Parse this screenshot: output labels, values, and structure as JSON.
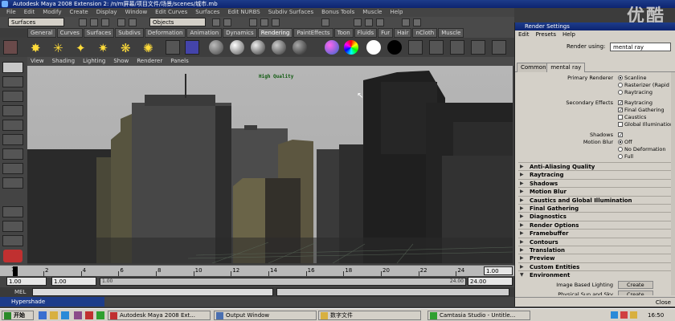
{
  "window": {
    "title": "Autodesk Maya 2008 Extension 2: /n/m屏幕/项目文件/场景/scenes/城市.mb",
    "watermark": "优酷"
  },
  "menubar": [
    "File",
    "Edit",
    "Modify",
    "Create",
    "Display",
    "Window",
    "Edit Curves",
    "Surfaces",
    "Edit NURBS",
    "Subdiv Surfaces",
    "Bonus Tools",
    "Muscle",
    "Help"
  ],
  "statusline": {
    "menuset": "Surfaces",
    "selection_mode": "Objects"
  },
  "shelf_tabs": [
    {
      "label": "General",
      "active": false
    },
    {
      "label": "Curves",
      "active": false
    },
    {
      "label": "Surfaces",
      "active": false
    },
    {
      "label": "Subdivs",
      "active": false
    },
    {
      "label": "Deformation",
      "active": false
    },
    {
      "label": "Animation",
      "active": false
    },
    {
      "label": "Dynamics",
      "active": false
    },
    {
      "label": "Rendering",
      "active": true
    },
    {
      "label": "PaintEffects",
      "active": false
    },
    {
      "label": "Toon",
      "active": false
    },
    {
      "label": "Fluids",
      "active": false
    },
    {
      "label": "Fur",
      "active": false
    },
    {
      "label": "Hair",
      "active": false
    },
    {
      "label": "nCloth",
      "active": false
    },
    {
      "label": "Muscle",
      "active": false
    }
  ],
  "panel_menu": [
    "View",
    "Shading",
    "Lighting",
    "Show",
    "Renderer",
    "Panels"
  ],
  "viewport": {
    "overlay_text": "High Quality"
  },
  "timeslider": {
    "ticks": [
      "2",
      "4",
      "6",
      "8",
      "10",
      "12",
      "14",
      "16",
      "18",
      "20",
      "22",
      "24"
    ],
    "current_frame": "1",
    "current_field": "1.00"
  },
  "range": {
    "start_time": "1.00",
    "playback_start": "1.00",
    "range_start_label": "1.00",
    "range_end_label": "24.00",
    "playback_end": "24.00"
  },
  "command_line": {
    "label": "MEL"
  },
  "render_settings": {
    "title": "Render Settings",
    "menus": [
      "Edit",
      "Presets",
      "Help"
    ],
    "render_using_label": "Render using:",
    "render_using_value": "mental ray",
    "tabs": [
      {
        "label": "Common",
        "active": false
      },
      {
        "label": "mental ray",
        "active": true
      }
    ],
    "primary_renderer_label": "Primary Renderer",
    "primary_renderer_options": [
      {
        "label": "Scanline",
        "selected": true
      },
      {
        "label": "Rasterizer (Rapid Motion)",
        "selected": false
      },
      {
        "label": "Raytracing",
        "selected": false
      }
    ],
    "secondary_effects_label": "Secondary Effects",
    "secondary_effects_options": [
      {
        "label": "Raytracing",
        "checked": true
      },
      {
        "label": "Final Gathering",
        "checked": true
      },
      {
        "label": "Caustics",
        "checked": false
      },
      {
        "label": "Global Illumination",
        "checked": false
      }
    ],
    "shadows_label": "Shadows",
    "shadows_checked": true,
    "motion_blur_label": "Motion Blur",
    "motion_blur_options": [
      {
        "label": "Off",
        "selected": true
      },
      {
        "label": "No Deformation",
        "selected": false
      },
      {
        "label": "Full",
        "selected": false
      }
    ],
    "sections": [
      {
        "label": "Anti-Aliasing Quality",
        "open": false
      },
      {
        "label": "Raytracing",
        "open": false
      },
      {
        "label": "Shadows",
        "open": false
      },
      {
        "label": "Motion Blur",
        "open": false
      },
      {
        "label": "Caustics and Global Illumination",
        "open": false
      },
      {
        "label": "Final Gathering",
        "open": false
      },
      {
        "label": "Diagnostics",
        "open": false
      },
      {
        "label": "Render Options",
        "open": false
      },
      {
        "label": "Framebuffer",
        "open": false
      },
      {
        "label": "Contours",
        "open": false
      },
      {
        "label": "Translation",
        "open": false
      },
      {
        "label": "Preview",
        "open": false
      },
      {
        "label": "Custom Entities",
        "open": false
      },
      {
        "label": "Environment",
        "open": true
      }
    ],
    "environment_items": [
      "Image Based Lighting",
      "Physical Sun and Sky"
    ],
    "create_label": "Create",
    "close_label": "Close"
  },
  "taskbar": {
    "start_label": "开始",
    "buttons": [
      "Autodesk Maya 2008 Ext...",
      "Output Window",
      "数字文件",
      "Camtasia Studio - Untitle..."
    ],
    "clock": "16:50"
  },
  "hypershade_label": "Hypershade",
  "colors": {
    "maya_bg": "#444444",
    "title_blue": "#0d2470",
    "win_gray": "#d4d0c8",
    "viewport_sky": "#b8b8b8"
  }
}
